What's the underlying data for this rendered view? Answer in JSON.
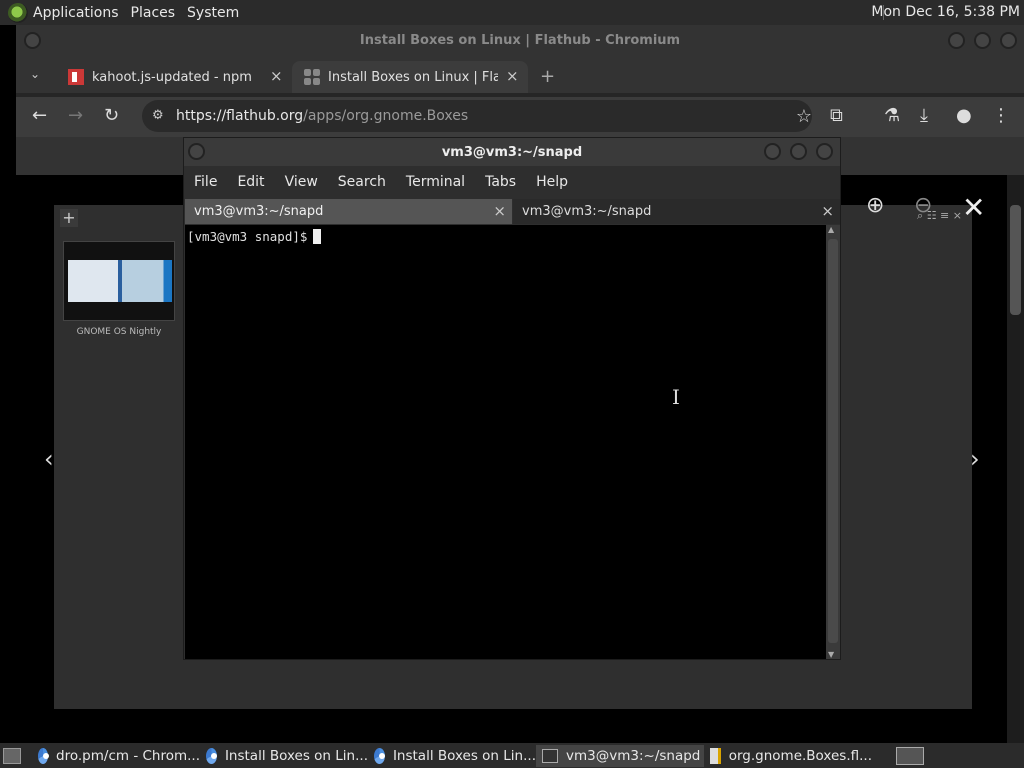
{
  "top_panel": {
    "menu": [
      "Applications",
      "Places",
      "System"
    ],
    "clock": "Mon Dec 16,  5:38 PM"
  },
  "chromium": {
    "window_title": "Install Boxes on Linux | Flathub - Chromium",
    "tabs": [
      {
        "title": "kahoot.js-updated - npm",
        "close": "×"
      },
      {
        "title": "Install Boxes on Linux | Flath",
        "close": "×"
      }
    ],
    "new_tab": "+",
    "tab_menu": "⌄",
    "url_host": "https://flathub.org",
    "url_path": "/apps/org.gnome.Boxes",
    "toolbar_icons": {
      "back": "←",
      "forward": "→",
      "reload": "↻",
      "star": "☆",
      "extensions": "⧉",
      "labs": "⚗",
      "download": "⤓",
      "profile": "●",
      "menu": "⋮"
    },
    "page": {
      "plus": "+",
      "thumb_label": "GNOME OS Nightly",
      "close": "✕",
      "prev": "‹",
      "next": "›",
      "zoom_in": "⊕",
      "zoom_out": "⊖",
      "mini_icons": "⌕ ☷ ≡ ×"
    }
  },
  "terminal": {
    "title": "vm3@vm3:~/snapd",
    "menu": [
      "File",
      "Edit",
      "View",
      "Search",
      "Terminal",
      "Tabs",
      "Help"
    ],
    "tabs": [
      {
        "title": "vm3@vm3:~/snapd",
        "close": "×"
      },
      {
        "title": "vm3@vm3:~/snapd",
        "close": "×"
      }
    ],
    "prompt": "[vm3@vm3 snapd]$",
    "pointer": "I"
  },
  "taskbar": {
    "tasks": [
      {
        "label": "dro.pm/cm - Chrom...",
        "icon": "chromium-icon"
      },
      {
        "label": "Install Boxes on Lin...",
        "icon": "chromium-icon"
      },
      {
        "label": "Install Boxes on Lin...",
        "icon": "chromium-icon"
      },
      {
        "label": "vm3@vm3:~/snapd",
        "icon": "terminal-icon"
      },
      {
        "label": "org.gnome.Boxes.fl...",
        "icon": "text-editor-icon"
      }
    ]
  }
}
